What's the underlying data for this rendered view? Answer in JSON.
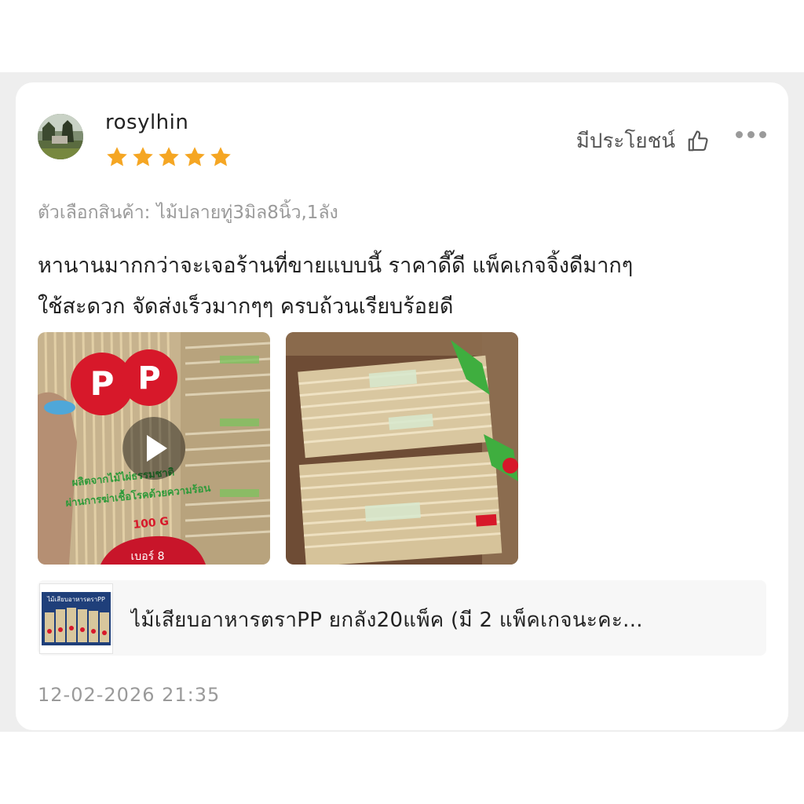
{
  "review": {
    "username": "rosylhin",
    "rating": 5,
    "helpful_label": "มีประโยชน์",
    "variant_label": "ตัวเลือกสินค้า:",
    "variant_value": "ไม้ปลายทู่3มิล8นิ้ว,1ลัง",
    "text_line1": "หานานมากกว่าจะเจอร้านที่ขายแบบนี้ ราคาดี๊ดี แพ็คเกจจิ้งดีมากๆ",
    "text_line2": "ใช้สะดวก จัดส่งเร็วมากๆๆ ครบถ้วนเรียบร้อยดี",
    "timestamp": "12-02-2026 21:35"
  },
  "media": {
    "video_logo": "P",
    "video_label_line1": "ผลิตจากไม้ไผ่ธรรมชาติ",
    "video_label_line2": "ผ่านการฆ่าเชื้อโรคด้วยความร้อน",
    "video_count": "100 G",
    "video_size": "เบอร์ 8"
  },
  "product": {
    "brand_banner": "ไม้เสียบอาหารตราPP",
    "title": "ไม้เสียบอาหารตราPP ยกลัง20แพ็ค (มี 2 แพ็คเกจนะคะ..."
  },
  "icons": {
    "star": "star-icon",
    "helpful": "thumbs-up-icon",
    "more": "more-dots-icon",
    "play": "play-icon"
  },
  "colors": {
    "star": "#f5a623",
    "brand_red": "#d7182a",
    "text_primary": "#222222",
    "text_muted": "#9a9a9a"
  }
}
